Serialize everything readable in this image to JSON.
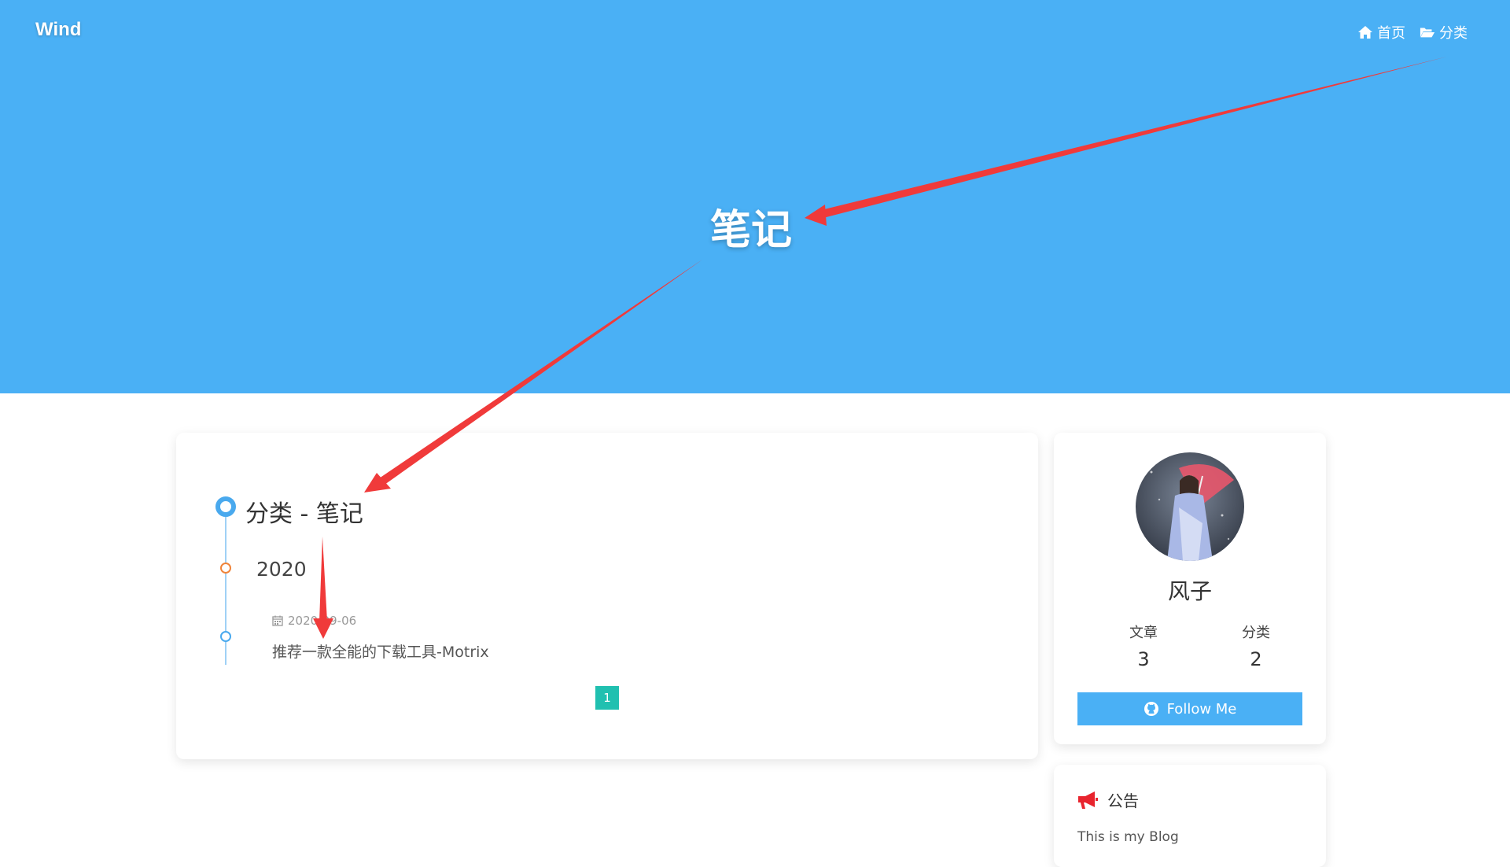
{
  "header": {
    "brand": "Wind",
    "nav": [
      {
        "label": "首页",
        "icon": "home-icon"
      },
      {
        "label": "分类",
        "icon": "folder-open-icon"
      }
    ],
    "title": "笔记"
  },
  "archive": {
    "heading": "分类 - 笔记",
    "year": "2020",
    "posts": [
      {
        "date": "2020-09-06",
        "title": "推荐一款全能的下载工具-Motrix"
      }
    ],
    "page": "1"
  },
  "profile": {
    "name": "风子",
    "stats": [
      {
        "label": "文章",
        "value": "3"
      },
      {
        "label": "分类",
        "value": "2"
      }
    ],
    "follow_label": "Follow Me"
  },
  "notice": {
    "heading": "公告",
    "text": "This is my Blog"
  },
  "colors": {
    "hero": "#4ab0f5",
    "accent": "#49a9ee",
    "pagination": "#20c0b0",
    "annotation_arrow": "#f03a3a"
  }
}
